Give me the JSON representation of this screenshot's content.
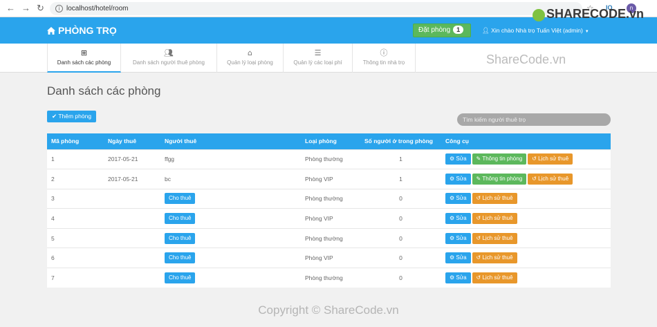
{
  "browser": {
    "url": "localhost/hotel/room",
    "profile_initial": "n",
    "ext_label": "IQ"
  },
  "header": {
    "brand": "PHÒNG TRỌ",
    "book_button": "Đặt phòng",
    "book_count": "1",
    "greeting": "Xin chào Nhà trọ Tuấn Việt (admin)"
  },
  "tabs": [
    {
      "label": "Danh sách các phòng",
      "icon": "sitemap-icon"
    },
    {
      "label": "Danh sách người thuê phòng",
      "icon": "users-icon"
    },
    {
      "label": "Quản lý loại phòng",
      "icon": "home-icon"
    },
    {
      "label": "Quản lý các loại phí",
      "icon": "list-icon"
    },
    {
      "label": "Thông tin nhà trọ",
      "icon": "info-icon"
    }
  ],
  "page": {
    "title": "Danh sách các phòng",
    "add_button": "Thêm phòng",
    "search_placeholder": "Tìm kiếm người thuê trọ"
  },
  "table": {
    "headers": [
      "Mã phòng",
      "Ngày thuê",
      "Người thuê",
      "Loại phòng",
      "Số người ở trong phòng",
      "Công cụ"
    ],
    "action_labels": {
      "edit": "Sửa",
      "info": "Thông tin phòng",
      "history": "Lịch sử thuê",
      "rent": "Cho thuê"
    },
    "rows": [
      {
        "id": "1",
        "date": "2017-05-21",
        "tenant": "ffgg",
        "type": "Phòng thường",
        "count": "1"
      },
      {
        "id": "2",
        "date": "2017-05-21",
        "tenant": "bc",
        "type": "Phòng VIP",
        "count": "1"
      },
      {
        "id": "3",
        "date": "",
        "tenant": "",
        "type": "Phòng thường",
        "count": "0"
      },
      {
        "id": "4",
        "date": "",
        "tenant": "",
        "type": "Phòng VIP",
        "count": "0"
      },
      {
        "id": "5",
        "date": "",
        "tenant": "",
        "type": "Phòng thường",
        "count": "0"
      },
      {
        "id": "6",
        "date": "",
        "tenant": "",
        "type": "Phòng VIP",
        "count": "0"
      },
      {
        "id": "7",
        "date": "",
        "tenant": "",
        "type": "Phòng thường",
        "count": "0"
      }
    ]
  },
  "watermark": {
    "top": "SHARECODE.vn",
    "middle": "ShareCode.vn",
    "bottom": "Copyright © ShareCode.vn"
  },
  "colors": {
    "primary": "#2aa4ec",
    "success": "#5cb85c",
    "warning": "#e8972b"
  }
}
